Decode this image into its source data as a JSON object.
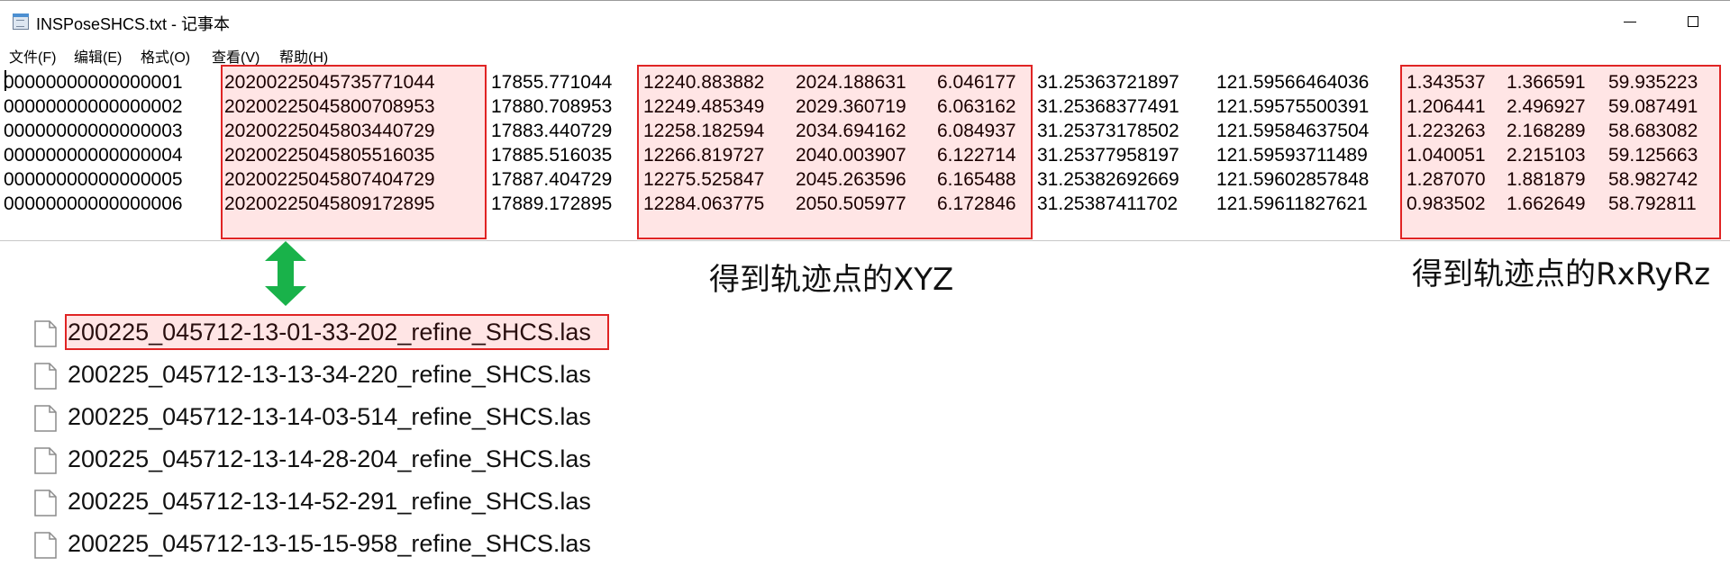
{
  "window": {
    "title": "INSPoseSHCS.txt - 记事本",
    "app_icon": "notepad-icon"
  },
  "menu": [
    {
      "label": "文件(F)"
    },
    {
      "label": "编辑(E)"
    },
    {
      "label": "格式(O)"
    },
    {
      "label": "查看(V)"
    },
    {
      "label": "帮助(H)"
    }
  ],
  "lines": [
    {
      "id": "00000000000000001",
      "timestamp": "20200225045735771044",
      "sec": "17855.771044",
      "x": "12240.883882",
      "y": "2024.188631",
      "z": "6.046177",
      "lat": "31.25363721897",
      "lon": "121.59566464036",
      "rx": "1.343537",
      "ry": "1.366591",
      "rz": "59.935223"
    },
    {
      "id": "00000000000000002",
      "timestamp": "20200225045800708953",
      "sec": "17880.708953",
      "x": "12249.485349",
      "y": "2029.360719",
      "z": "6.063162",
      "lat": "31.25368377491",
      "lon": "121.59575500391",
      "rx": "1.206441",
      "ry": "2.496927",
      "rz": "59.087491"
    },
    {
      "id": "00000000000000003",
      "timestamp": "20200225045803440729",
      "sec": "17883.440729",
      "x": "12258.182594",
      "y": "2034.694162",
      "z": "6.084937",
      "lat": "31.25373178502",
      "lon": "121.59584637504",
      "rx": "1.223263",
      "ry": "2.168289",
      "rz": "58.683082"
    },
    {
      "id": "00000000000000004",
      "timestamp": "20200225045805516035",
      "sec": "17885.516035",
      "x": "12266.819727",
      "y": "2040.003907",
      "z": "6.122714",
      "lat": "31.25377958197",
      "lon": "121.59593711489",
      "rx": "1.040051",
      "ry": "2.215103",
      "rz": "59.125663"
    },
    {
      "id": "00000000000000005",
      "timestamp": "20200225045807404729",
      "sec": "17887.404729",
      "x": "12275.525847",
      "y": "2045.263596",
      "z": "6.165488",
      "lat": "31.25382692669",
      "lon": "121.59602857848",
      "rx": "1.287070",
      "ry": "1.881879",
      "rz": "58.982742"
    },
    {
      "id": "00000000000000006",
      "timestamp": "20200225045809172895",
      "sec": "17889.172895",
      "x": "12284.063775",
      "y": "2050.505977",
      "z": "6.172846",
      "lat": "31.25387411702",
      "lon": "121.59611827621",
      "rx": "0.983502",
      "ry": "1.662649",
      "rz": "58.792811"
    }
  ],
  "annotations": {
    "xyz_caption": "得到轨迹点的XYZ",
    "rxryrz_caption": "得到轨迹点的RxRyRz",
    "highlight_color": "#e02424",
    "arrow_color": "#19b24a"
  },
  "files": [
    {
      "name": "200225_045712-13-01-33-202_refine_SHCS.las",
      "highlighted": true
    },
    {
      "name": "200225_045712-13-13-34-220_refine_SHCS.las",
      "highlighted": false
    },
    {
      "name": "200225_045712-13-14-03-514_refine_SHCS.las",
      "highlighted": false
    },
    {
      "name": "200225_045712-13-14-28-204_refine_SHCS.las",
      "highlighted": false
    },
    {
      "name": "200225_045712-13-14-52-291_refine_SHCS.las",
      "highlighted": false
    },
    {
      "name": "200225_045712-13-15-15-958_refine_SHCS.las",
      "highlighted": false
    }
  ]
}
